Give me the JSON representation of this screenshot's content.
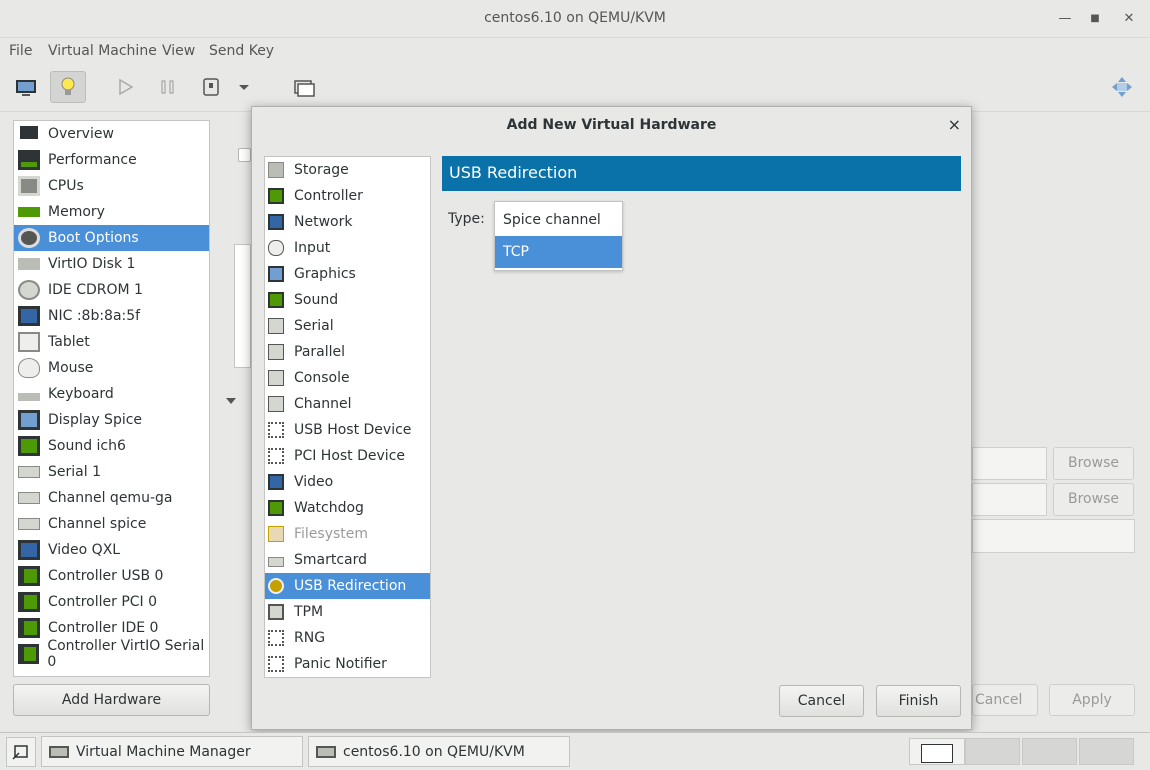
{
  "window": {
    "title": "centos6.10 on QEMU/KVM"
  },
  "menubar": {
    "items": [
      "File",
      "Virtual Machine",
      "View",
      "Send Key"
    ]
  },
  "left_list": {
    "items": [
      "Overview",
      "Performance",
      "CPUs",
      "Memory",
      "Boot Options",
      "VirtIO Disk 1",
      "IDE CDROM 1",
      "NIC :8b:8a:5f",
      "Tablet",
      "Mouse",
      "Keyboard",
      "Display Spice",
      "Sound ich6",
      "Serial 1",
      "Channel qemu-ga",
      "Channel spice",
      "Video QXL",
      "Controller USB 0",
      "Controller PCI 0",
      "Controller IDE 0",
      "Controller VirtIO Serial 0"
    ],
    "selected": "Boot Options"
  },
  "left_buttons": {
    "add_hardware": "Add Hardware"
  },
  "background": {
    "browse_1": "Browse",
    "browse_2": "Browse",
    "cancel": "Cancel",
    "apply": "Apply"
  },
  "dialog": {
    "title": "Add New Virtual Hardware",
    "close": "×",
    "hardware_list": [
      "Storage",
      "Controller",
      "Network",
      "Input",
      "Graphics",
      "Sound",
      "Serial",
      "Parallel",
      "Console",
      "Channel",
      "USB Host Device",
      "PCI Host Device",
      "Video",
      "Watchdog",
      "Filesystem",
      "Smartcard",
      "USB Redirection",
      "TPM",
      "RNG",
      "Panic Notifier"
    ],
    "selected": "USB Redirection",
    "disabled": "Filesystem",
    "header": "USB Redirection",
    "type_label": "Type:",
    "type_options": [
      "Spice channel",
      "TCP"
    ],
    "type_selected": "TCP",
    "cancel_label": "Cancel",
    "finish_label": "Finish"
  },
  "taskbar": {
    "tasks": [
      "Virtual Machine Manager",
      "centos6.10 on QEMU/KVM"
    ]
  },
  "colors": {
    "accent": "#4a90d9",
    "header": "#0b72a9"
  }
}
